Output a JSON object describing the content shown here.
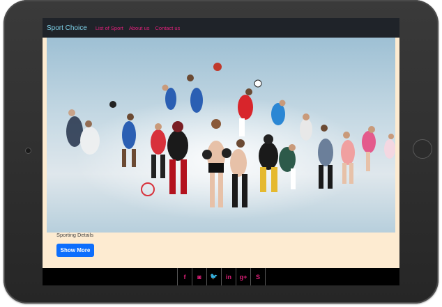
{
  "navbar": {
    "brand": "Sport Choice",
    "links": [
      "List of Sport",
      "About us",
      "Contact us"
    ]
  },
  "hero": {
    "image_alt": "athletes-collage"
  },
  "content": {
    "caption": "Sporting Details",
    "button_label": "Show More"
  },
  "footer": {
    "social_icons": [
      {
        "name": "facebook-icon",
        "glyph": "f"
      },
      {
        "name": "instagram-icon",
        "glyph": "◙"
      },
      {
        "name": "twitter-icon",
        "glyph": "🐦"
      },
      {
        "name": "linkedin-icon",
        "glyph": "in"
      },
      {
        "name": "google-plus-icon",
        "glyph": "g+"
      },
      {
        "name": "skype-icon",
        "glyph": "S"
      }
    ]
  },
  "colors": {
    "navbar_bg": "#1f2329",
    "brand": "#7fd3ea",
    "link": "#e0207a",
    "page_bg": "#fdebd1",
    "button": "#0d6efd",
    "footer_bg": "#000000"
  }
}
